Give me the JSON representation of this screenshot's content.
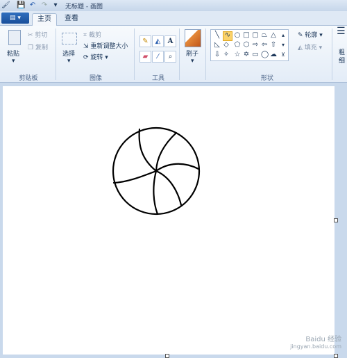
{
  "window": {
    "title": "无标题 - 画图"
  },
  "quick_access": {
    "save_icon": "floppy-icon",
    "undo_icon": "undo-icon",
    "redo_icon": "redo-icon",
    "more": "▾"
  },
  "tabs": {
    "file_label": "▾",
    "home": "主页",
    "view": "查看"
  },
  "clipboard": {
    "paste": "粘贴",
    "cut": "剪切",
    "copy": "复制",
    "group": "剪贴板"
  },
  "image": {
    "select": "选择",
    "crop": "裁剪",
    "resize": "重新调整大小",
    "rotate": "旋转",
    "group": "图像"
  },
  "tools": {
    "group": "工具",
    "text_tool": "A"
  },
  "brushes": {
    "label": "刷子"
  },
  "shapes": {
    "outline": "轮廓",
    "fill": "填充",
    "group": "形状"
  },
  "colors": {
    "partial_label": "粗\n细"
  },
  "watermark": {
    "line1": "Baidu 经验",
    "line2": "jingyan.baidu.com"
  }
}
